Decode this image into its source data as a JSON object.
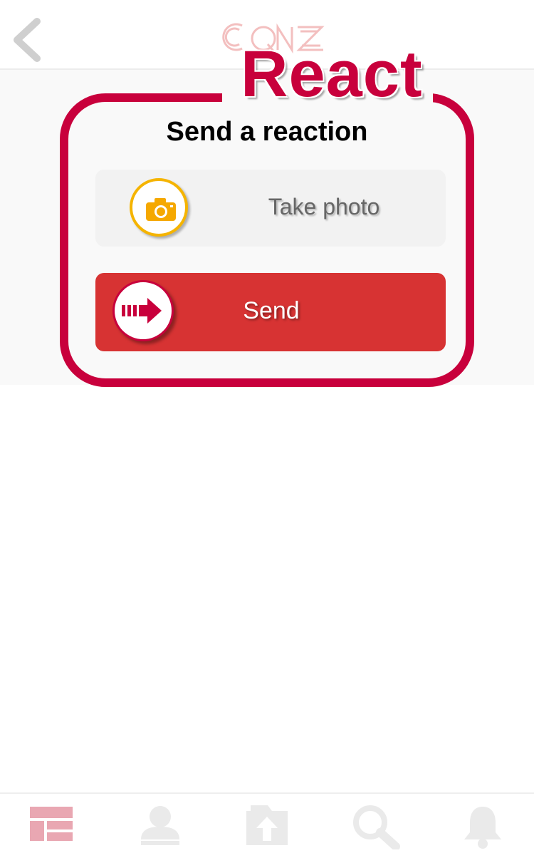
{
  "header": {
    "back_icon": "chevron-left-icon",
    "logo_text": "CQNZ"
  },
  "callout": {
    "label": "React",
    "accent_color": "#c8003c"
  },
  "dialog": {
    "title": "Send a reaction",
    "take_photo_label": "Take photo",
    "take_photo_icon": "camera-icon",
    "send_label": "Send",
    "send_icon": "arrow-right-icon",
    "send_color": "#d73333"
  },
  "tabbar": {
    "items": [
      {
        "icon": "dashboard-icon"
      },
      {
        "icon": "profile-icon"
      },
      {
        "icon": "upload-icon"
      },
      {
        "icon": "search-icon"
      },
      {
        "icon": "bell-icon"
      }
    ],
    "icon_color": "#e9a7b2"
  }
}
